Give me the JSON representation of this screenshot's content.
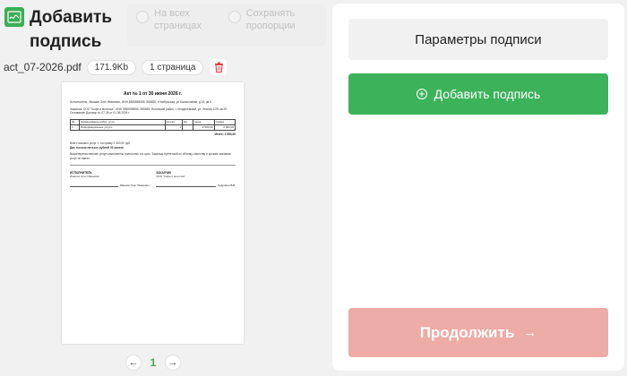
{
  "header": {
    "title": "Добавить подпись",
    "options": [
      {
        "label": "На всех страницах"
      },
      {
        "label": "Сохранять пропорции"
      }
    ]
  },
  "file": {
    "name": "act_07-2026.pdf",
    "size": "171.9Kb",
    "pages": "1 страница"
  },
  "document": {
    "title": "Акт № 1 от 30 июня 2026 г.",
    "executor": "Исполнитель: Ивашов Олег Иванович, ИНН 5555555555, 555555, г.Ноябрьская, ул.Космонавтов, д.15, кв.3",
    "customer": "Заказчик: ООО \"Кофе и молочка\", ИНН 5555555555, 555555, Ногинский район, г. Кенденевский, ул. Лесная 1/25, кв.29",
    "basis": "Основание: Договор № 07-26 от 01.06.2026 г.",
    "table_head": [
      "№",
      "Наименование работ, услуг",
      "Кол-во",
      "Ед.",
      "Цена",
      "Сумма"
    ],
    "table_row": [
      "1",
      "Информационные услуги",
      "1",
      "",
      "2 500,00",
      "2 500,00"
    ],
    "total": "Итого: 2 500,00",
    "summary": "Всего оказано услуг 1, на сумму 2 500,00 руб.",
    "summary_words": "Две тысячи пятьсот рублей 00 копеек",
    "note": "Вышеперечисленные услуги выполнены полностью и в срок. Заказчик претензий по объему, качеству и срокам оказания услуг не имеет.",
    "left_sign_head": "ИСПОЛНИТЕЛЬ",
    "left_sign_name": "Ивашов Олег Иванович",
    "left_sign_short": "Ивашов Олег Иванович",
    "right_sign_head": "ЗАКАЗЧИК",
    "right_sign_name": "ООО \"Кофе и молочка\"",
    "right_sign_short": "Кудрявин В.В."
  },
  "pager": {
    "prev": "←",
    "current": "1",
    "next": "→"
  },
  "panel": {
    "title": "Параметры подписи",
    "add_label": "Добавить подпись",
    "continue_label": "Продолжить",
    "continue_arrow": "→"
  },
  "colors": {
    "accent": "#3cb35a",
    "continue_disabled": "#eeaca6",
    "trash": "#e04040"
  }
}
